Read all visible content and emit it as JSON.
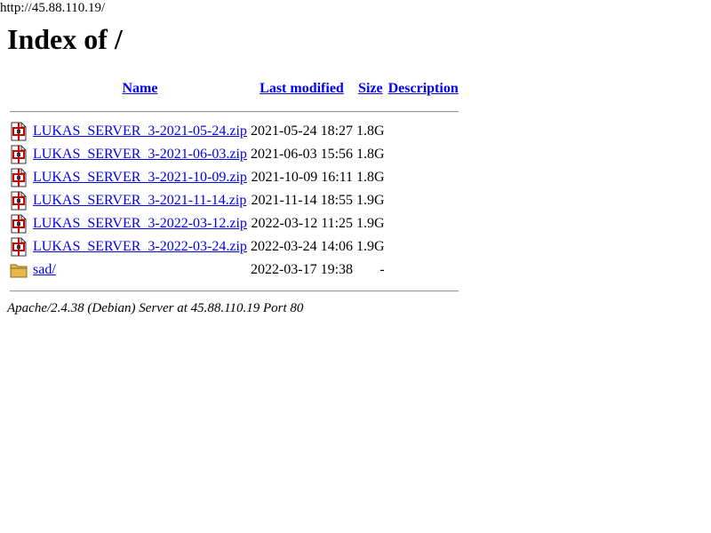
{
  "url": "http://45.88.110.19/",
  "title": "Index of /",
  "columns": {
    "name": "Name",
    "last_modified": "Last modified",
    "size": "Size",
    "description": "Description"
  },
  "rows": [
    {
      "icon": "compressed-file-icon",
      "name": "LUKAS_SERVER_3-2021-05-24.zip",
      "modified": "2021-05-24 18:27",
      "size": "1.8G",
      "description": ""
    },
    {
      "icon": "compressed-file-icon",
      "name": "LUKAS_SERVER_3-2021-06-03.zip",
      "modified": "2021-06-03 15:56",
      "size": "1.8G",
      "description": ""
    },
    {
      "icon": "compressed-file-icon",
      "name": "LUKAS_SERVER_3-2021-10-09.zip",
      "modified": "2021-10-09 16:11",
      "size": "1.8G",
      "description": ""
    },
    {
      "icon": "compressed-file-icon",
      "name": "LUKAS_SERVER_3-2021-11-14.zip",
      "modified": "2021-11-14 18:55",
      "size": "1.9G",
      "description": ""
    },
    {
      "icon": "compressed-file-icon",
      "name": "LUKAS_SERVER_3-2022-03-12.zip",
      "modified": "2022-03-12 11:25",
      "size": "1.9G",
      "description": ""
    },
    {
      "icon": "compressed-file-icon",
      "name": "LUKAS_SERVER_3-2022-03-24.zip",
      "modified": "2022-03-24 14:06",
      "size": "1.9G",
      "description": ""
    },
    {
      "icon": "folder-icon",
      "name": "sad/",
      "modified": "2022-03-17 19:38",
      "size": "-",
      "description": ""
    }
  ],
  "footer": "Apache/2.4.38 (Debian) Server at 45.88.110.19 Port 80",
  "colors": {
    "link": "#0000ee",
    "text": "#000000",
    "folder": "#d9a441",
    "archive_red": "#cc0000"
  }
}
